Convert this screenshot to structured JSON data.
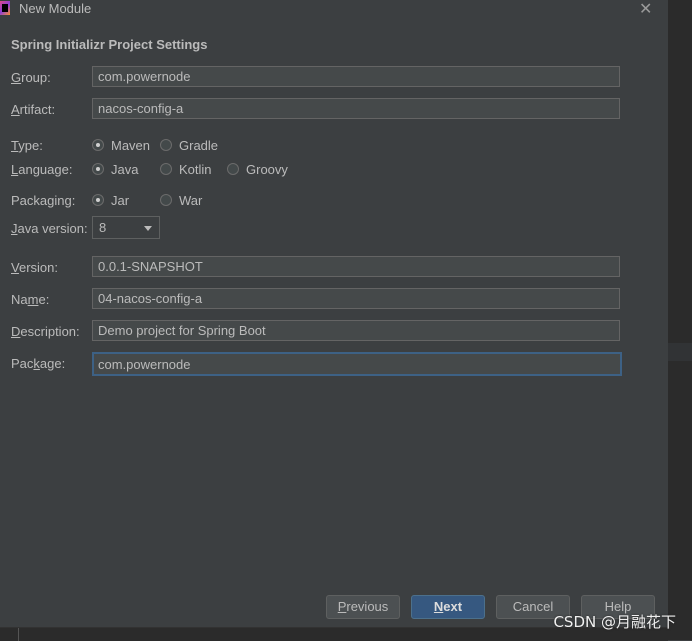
{
  "window": {
    "title": "New Module",
    "close_symbol": "✕"
  },
  "section_title": "Spring Initializr Project Settings",
  "fields": {
    "group": {
      "label_mnemonic": "G",
      "label_rest": "roup:",
      "value": "com.powernode"
    },
    "artifact": {
      "label_mnemonic": "A",
      "label_rest": "rtifact:",
      "value": "nacos-config-a"
    },
    "version": {
      "label_mnemonic": "V",
      "label_rest": "ersion:",
      "value": "0.0.1-SNAPSHOT"
    },
    "name": {
      "label_pre": "Na",
      "label_mnemonic": "m",
      "label_rest": "e:",
      "value": "04-nacos-config-a"
    },
    "description": {
      "label_mnemonic": "D",
      "label_rest": "escription:",
      "value": "Demo project for Spring Boot"
    },
    "package": {
      "label_pre": "Pac",
      "label_mnemonic": "k",
      "label_rest": "age:",
      "value": "com.powernode"
    }
  },
  "type": {
    "label_mnemonic": "T",
    "label_rest": "ype:",
    "options": [
      "Maven",
      "Gradle"
    ],
    "selected": "Maven"
  },
  "language": {
    "label_mnemonic": "L",
    "label_rest": "anguage:",
    "options": [
      "Java",
      "Kotlin",
      "Groovy"
    ],
    "selected": "Java"
  },
  "packaging": {
    "label": "Packaging:",
    "options": [
      "Jar",
      "War"
    ],
    "selected": "Jar"
  },
  "java_version": {
    "label_mnemonic": "J",
    "label_rest": "ava version:",
    "value": "8"
  },
  "buttons": {
    "previous": {
      "mnemonic": "P",
      "rest": "revious"
    },
    "next": {
      "mnemonic": "N",
      "rest": "ext"
    },
    "cancel": {
      "label": "Cancel"
    },
    "help": {
      "label": "Help"
    }
  },
  "watermark": "CSDN @月融花下",
  "colors": {
    "background": "#3c3f41",
    "field_bg": "#45494a",
    "focus_border": "#3d6185",
    "primary_button": "#365880"
  }
}
